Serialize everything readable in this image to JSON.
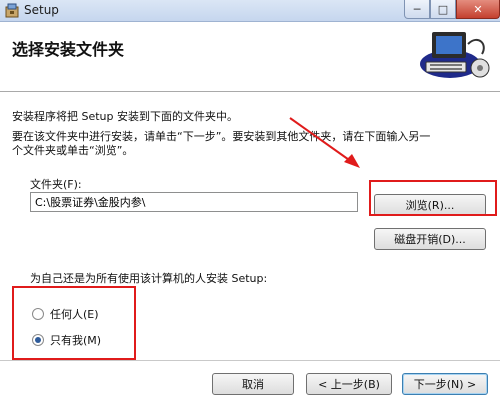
{
  "window": {
    "title": "Setup",
    "icon": "installer-icon",
    "controls": {
      "minimize": "─",
      "maximize": "□",
      "close": "✕"
    }
  },
  "header": {
    "title": "选择安装文件夹",
    "art_icon": "computer-installer-icon"
  },
  "body": {
    "intro": "安装程序将把 Setup 安装到下面的文件夹中。",
    "instruction_line1": "要在该文件夹中进行安装，请单击“下一步”。要安装到其他文件夹，请在下面输入另一",
    "instruction_line2": "个文件夹或单击“浏览”。"
  },
  "folder": {
    "label": "文件夹(F):",
    "value": "C:\\股票证券\\金股内参\\"
  },
  "buttons": {
    "browse": "浏览(R)...",
    "disk_cost": "磁盘开销(D)...",
    "cancel": "取消",
    "back": "< 上一步(B)",
    "next": "下一步(N) >"
  },
  "install_for": {
    "label": "为自己还是为所有使用该计算机的人安装 Setup:",
    "options": [
      {
        "label": "任何人(E)",
        "selected": false
      },
      {
        "label": "只有我(M)",
        "selected": true
      }
    ]
  },
  "colors": {
    "highlight": "#e01b1b",
    "accent": "#2e5b9a"
  }
}
